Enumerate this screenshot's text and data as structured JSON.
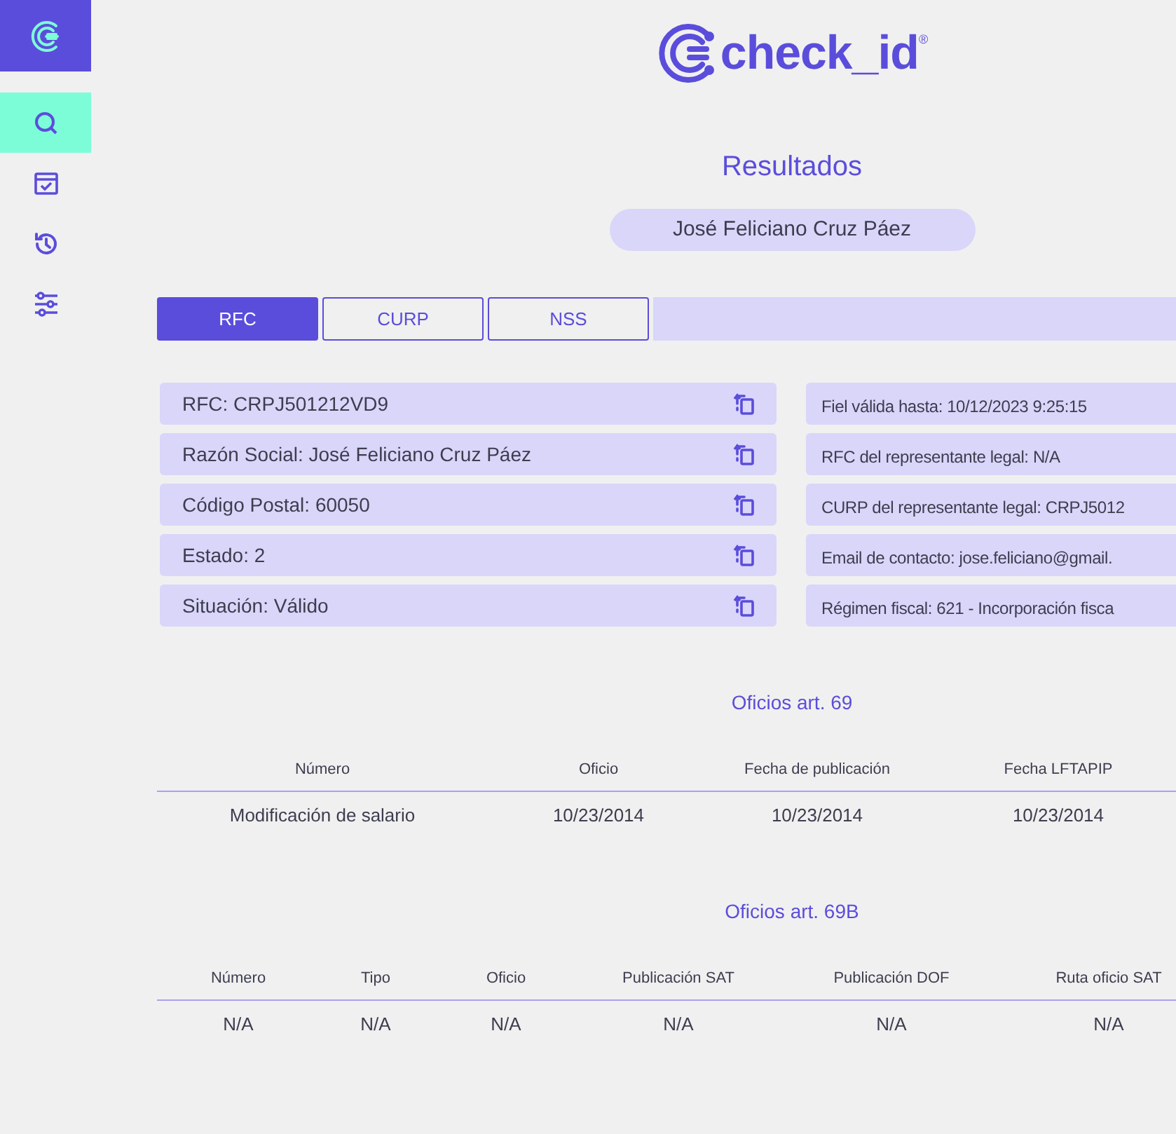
{
  "sidebar": {
    "items": [
      {
        "kind": "search",
        "selected": true
      },
      {
        "kind": "calendar",
        "selected": false
      },
      {
        "kind": "history",
        "selected": false
      },
      {
        "kind": "sliders",
        "selected": false
      }
    ]
  },
  "logo": {
    "text": "check_id",
    "mark": "®"
  },
  "title": "Resultados",
  "person": "José Feliciano Cruz Páez",
  "tabs": [
    {
      "label": "RFC",
      "selected": true
    },
    {
      "label": "CURP",
      "selected": false
    },
    {
      "label": "NSS",
      "selected": false
    }
  ],
  "fields_left": [
    "RFC: CRPJ501212VD9",
    "Razón Social: José Feliciano Cruz Páez",
    "Código Postal: 60050",
    "Estado: 2",
    "Situación: Válido"
  ],
  "fields_right": [
    "Fiel válida hasta: 10/12/2023  9:25:15",
    "RFC del representante legal: N/A",
    "CURP del representante legal: CRPJ5012",
    "Email de contacto: jose.feliciano@gmail.",
    "Régimen fiscal: 621 - Incorporación fisca"
  ],
  "tables": [
    {
      "title": "Oficios art. 69",
      "columns": [
        "Número",
        "Oficio",
        "Fecha de publicación",
        "Fecha LFTAPIP"
      ],
      "rows": [
        [
          "Modificación de salario",
          "10/23/2014",
          "10/23/2014",
          "10/23/2014"
        ]
      ]
    },
    {
      "title": "Oficios art. 69B",
      "columns": [
        "Número",
        "Tipo",
        "Oficio",
        "Publicación SAT",
        "Publicación DOF",
        "Ruta oficio SAT"
      ],
      "rows": [
        [
          "N/A",
          "N/A",
          "N/A",
          "N/A",
          "N/A",
          "N/A"
        ]
      ]
    }
  ]
}
